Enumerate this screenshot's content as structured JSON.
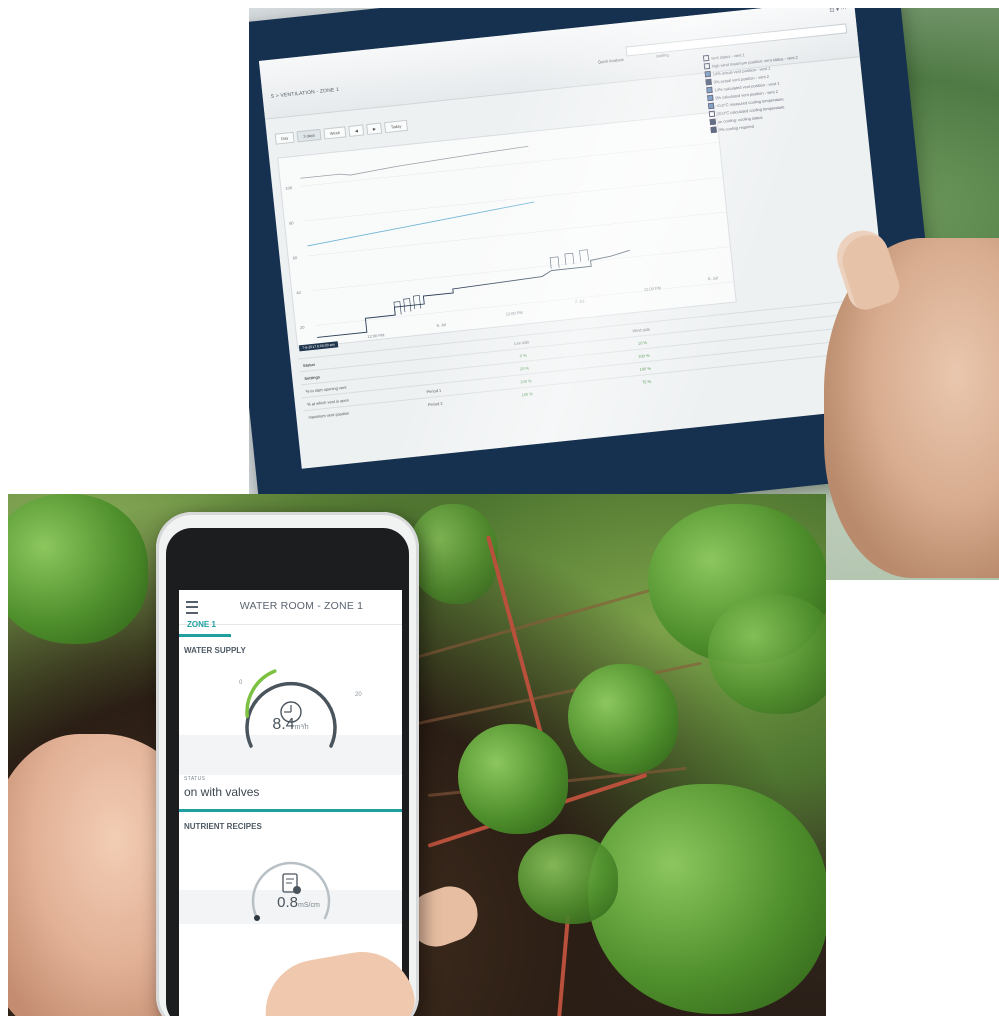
{
  "tablet": {
    "breadcrumb": "S > VENTILATION - ZONE 1",
    "header_icons": "⊡ ▾  ⋯",
    "quick_analysis_label": "Quick Analysis",
    "quick_analysis_value": "cooling",
    "buttons": [
      "Day",
      "3 days",
      "Week",
      "◀",
      "▶",
      "Today"
    ],
    "legend": [
      "vent status - vent 1",
      "high wind maximum position: vent status - vent 2",
      "14% actual vent position - vent 1",
      "9% actual vent position - vent 2",
      "14% calculated vent position - vent 1",
      "9% calculated vent position - vent 2",
      "+0.0°C measured cooling temperature",
      "20.0°C calculated cooling temperature",
      "on cooling: cooling status",
      "0% cooling required"
    ],
    "y_ticks": [
      "100",
      "80",
      "60",
      "40",
      "20"
    ],
    "x_ticks": [
      "12:00 PM",
      "8. Jul",
      "12:00 PM",
      "7. Jul",
      "12:00 PM",
      "8. Jul"
    ],
    "date_badge": "7-6-2017 6:00:00 am",
    "table": {
      "col_lee": "Lee side",
      "col_wind": "Wind side",
      "sections": [
        "Status",
        "Settings"
      ],
      "rows": [
        {
          "label": "",
          "period": "",
          "lee": "0 %",
          "wind": "10 %"
        },
        {
          "label": "% to start opening vent",
          "period": "",
          "lee": "20 %",
          "wind": "100 %"
        },
        {
          "label": "% at which vent is open",
          "period": "Period 1",
          "lee": "100 %",
          "wind": "100 %"
        },
        {
          "label": "maximum vent position",
          "period": "Period 2",
          "lee": "100 %",
          "wind": "75 %"
        }
      ]
    }
  },
  "phone": {
    "title": "WATER ROOM - ZONE 1",
    "tab": "ZONE 1",
    "water_supply": {
      "section": "WATER SUPPLY",
      "min": "0",
      "max": "20",
      "value": "8.4",
      "unit": "m³/h",
      "fraction": 0.42
    },
    "status_label": "STATUS",
    "status_value": "on with valves",
    "nutrient": {
      "section": "NUTRIENT RECIPES",
      "min": "0",
      "value": "0.8",
      "unit": "mS/cm"
    }
  },
  "colors": {
    "accent": "#1f9fa0",
    "gauge_green": "#7cc142",
    "gauge_dark": "#4a545c",
    "tablet_frame": "#163150"
  }
}
